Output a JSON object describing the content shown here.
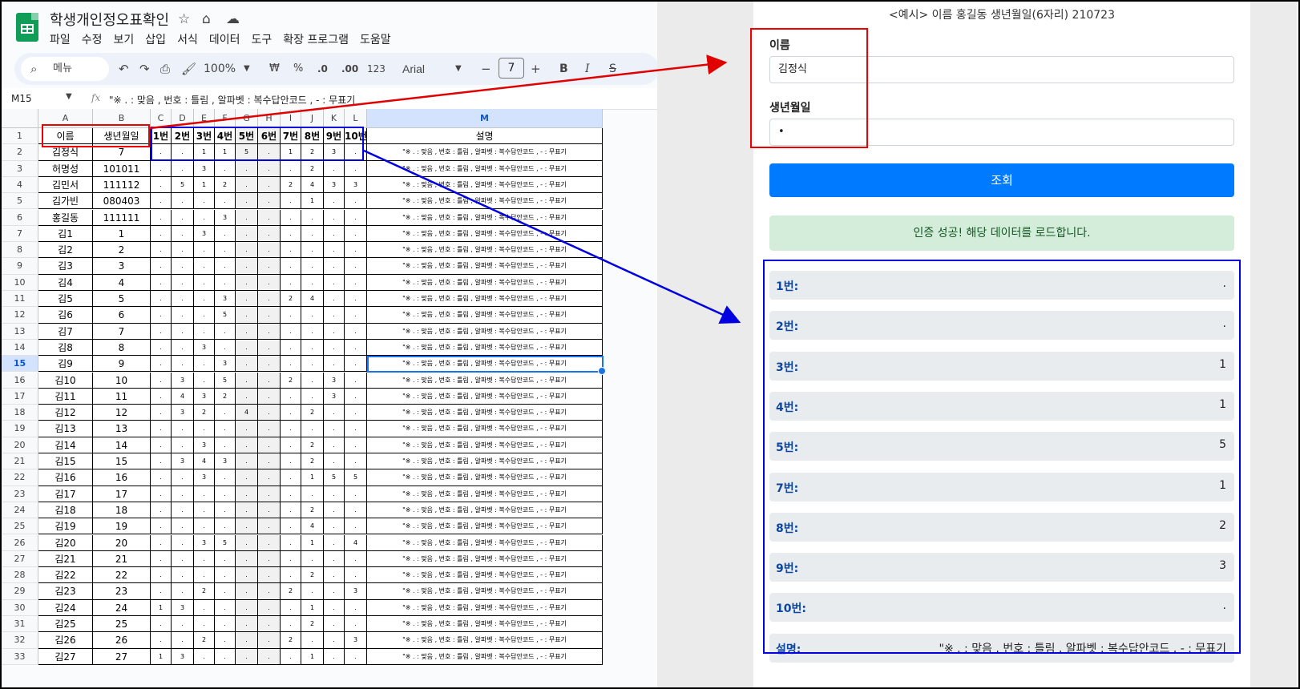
{
  "sheets": {
    "doc_title": "학생개인정오표확인",
    "menu": [
      "파일",
      "수정",
      "보기",
      "삽입",
      "서식",
      "데이터",
      "도구",
      "확장 프로그램",
      "도움말"
    ],
    "toolbar": {
      "search": "메뉴",
      "zoom": "100%",
      "currency": "₩",
      "percent": "%",
      "dec_less": ".0",
      "dec_more": ".00",
      "number_format": "123",
      "font": "Arial",
      "font_size": "7",
      "bold": "B",
      "italic": "I",
      "strike": "S"
    },
    "name_box": "M15",
    "formula": "\"※ . : 맞음 , 번호 : 틀림 , 알파벳 : 복수답안코드 , - : 무표기",
    "columns": [
      "A",
      "B",
      "C",
      "D",
      "E",
      "F",
      "G",
      "H",
      "I",
      "J",
      "K",
      "L",
      "M"
    ],
    "header": [
      "이름",
      "생년월일",
      "1번",
      "2번",
      "3번",
      "4번",
      "5번",
      "6번",
      "7번",
      "8번",
      "9번",
      "10번",
      "설명"
    ],
    "desc_text": "\"※ . : 맞음 , 번호 : 틀림 , 알파벳 : 복수답안코드 , - : 무표기",
    "rows": [
      [
        "김정식",
        "7",
        ".",
        ".",
        "1",
        "1",
        "5",
        ".",
        "1",
        "2",
        "3",
        "."
      ],
      [
        "허명성",
        "101011",
        ".",
        ".",
        "3",
        ".",
        ".",
        ".",
        ".",
        "2",
        ".",
        "."
      ],
      [
        "김민서",
        "111112",
        ".",
        "5",
        "1",
        "2",
        ".",
        ".",
        "2",
        "4",
        "3",
        "3"
      ],
      [
        "김가빈",
        "080403",
        ".",
        ".",
        ".",
        ".",
        ".",
        ".",
        ".",
        "1",
        ".",
        "."
      ],
      [
        "홍길동",
        "111111",
        ".",
        ".",
        ".",
        "3",
        ".",
        ".",
        ".",
        ".",
        ".",
        "."
      ],
      [
        "김1",
        "1",
        ".",
        ".",
        "3",
        ".",
        ".",
        ".",
        ".",
        ".",
        ".",
        "."
      ],
      [
        "김2",
        "2",
        ".",
        ".",
        ".",
        ".",
        ".",
        ".",
        ".",
        ".",
        ".",
        "."
      ],
      [
        "김3",
        "3",
        ".",
        ".",
        ".",
        ".",
        ".",
        ".",
        ".",
        ".",
        ".",
        "."
      ],
      [
        "김4",
        "4",
        ".",
        ".",
        ".",
        ".",
        ".",
        ".",
        ".",
        ".",
        ".",
        "."
      ],
      [
        "김5",
        "5",
        ".",
        ".",
        ".",
        "3",
        ".",
        ".",
        "2",
        "4",
        ".",
        "."
      ],
      [
        "김6",
        "6",
        ".",
        ".",
        ".",
        "5",
        ".",
        ".",
        ".",
        ".",
        ".",
        "."
      ],
      [
        "김7",
        "7",
        ".",
        ".",
        ".",
        ".",
        ".",
        ".",
        ".",
        ".",
        ".",
        "."
      ],
      [
        "김8",
        "8",
        ".",
        ".",
        "3",
        ".",
        ".",
        ".",
        ".",
        ".",
        ".",
        "."
      ],
      [
        "김9",
        "9",
        ".",
        ".",
        ".",
        "3",
        ".",
        ".",
        ".",
        ".",
        ".",
        "."
      ],
      [
        "김10",
        "10",
        ".",
        "3",
        ".",
        "5",
        ".",
        ".",
        "2",
        ".",
        "3",
        "."
      ],
      [
        "김11",
        "11",
        ".",
        "4",
        "3",
        "2",
        ".",
        ".",
        ".",
        ".",
        "3",
        "."
      ],
      [
        "김12",
        "12",
        ".",
        "3",
        "2",
        ".",
        "4",
        ".",
        ".",
        "2",
        ".",
        "."
      ],
      [
        "김13",
        "13",
        ".",
        ".",
        ".",
        ".",
        ".",
        ".",
        ".",
        ".",
        ".",
        "."
      ],
      [
        "김14",
        "14",
        ".",
        ".",
        "3",
        ".",
        ".",
        ".",
        ".",
        "2",
        ".",
        "."
      ],
      [
        "김15",
        "15",
        ".",
        "3",
        "4",
        "3",
        ".",
        ".",
        ".",
        "2",
        ".",
        "."
      ],
      [
        "김16",
        "16",
        ".",
        ".",
        "3",
        ".",
        ".",
        ".",
        ".",
        "1",
        "5",
        "5"
      ],
      [
        "김17",
        "17",
        ".",
        ".",
        ".",
        ".",
        ".",
        ".",
        ".",
        ".",
        ".",
        "."
      ],
      [
        "김18",
        "18",
        ".",
        ".",
        ".",
        ".",
        ".",
        ".",
        ".",
        "2",
        ".",
        "."
      ],
      [
        "김19",
        "19",
        ".",
        ".",
        ".",
        ".",
        ".",
        ".",
        ".",
        "4",
        ".",
        "."
      ],
      [
        "김20",
        "20",
        ".",
        ".",
        "3",
        "5",
        ".",
        ".",
        ".",
        "1",
        ".",
        "4"
      ],
      [
        "김21",
        "21",
        ".",
        ".",
        ".",
        ".",
        ".",
        ".",
        ".",
        ".",
        ".",
        "."
      ],
      [
        "김22",
        "22",
        ".",
        ".",
        ".",
        ".",
        ".",
        ".",
        ".",
        "2",
        ".",
        "."
      ],
      [
        "김23",
        "23",
        ".",
        ".",
        "2",
        ".",
        ".",
        ".",
        "2",
        ".",
        ".",
        "3"
      ],
      [
        "김24",
        "24",
        "1",
        "3",
        ".",
        ".",
        ".",
        ".",
        ".",
        "1",
        ".",
        "."
      ],
      [
        "김25",
        "25",
        ".",
        ".",
        ".",
        ".",
        ".",
        ".",
        ".",
        "2",
        ".",
        "."
      ],
      [
        "김26",
        "26",
        ".",
        ".",
        "2",
        ".",
        ".",
        ".",
        "2",
        ".",
        ".",
        "3"
      ],
      [
        "김27",
        "27",
        "1",
        "3",
        ".",
        ".",
        ".",
        ".",
        ".",
        "1",
        ".",
        "."
      ]
    ]
  },
  "app": {
    "example": "<예시> 이름 홍길동 생년월일(6자리) 210723",
    "name_label": "이름",
    "name_value": "김정식",
    "birth_label": "생년월일",
    "birth_value": "•",
    "query_button": "조회",
    "success_message": "인증 성공! 해당 데이터를 로드합니다.",
    "results": [
      {
        "label": "1번:",
        "value": "."
      },
      {
        "label": "2번:",
        "value": "."
      },
      {
        "label": "3번:",
        "value": "1"
      },
      {
        "label": "4번:",
        "value": "1"
      },
      {
        "label": "5번:",
        "value": "5"
      },
      {
        "label": "7번:",
        "value": "1"
      },
      {
        "label": "8번:",
        "value": "2"
      },
      {
        "label": "9번:",
        "value": "3"
      },
      {
        "label": "10번:",
        "value": "."
      },
      {
        "label": "설명:",
        "value": "\"※ . : 맞음 , 번호 : 틀림 , 알파벳 : 복수답안코드 , - : 무표기"
      }
    ]
  },
  "colors": {
    "annotation_red": "#e00000",
    "annotation_blue": "#0000e0",
    "button_blue": "#007bff",
    "success_bg": "#d4edda",
    "sheets_green": "#0f9d58"
  }
}
